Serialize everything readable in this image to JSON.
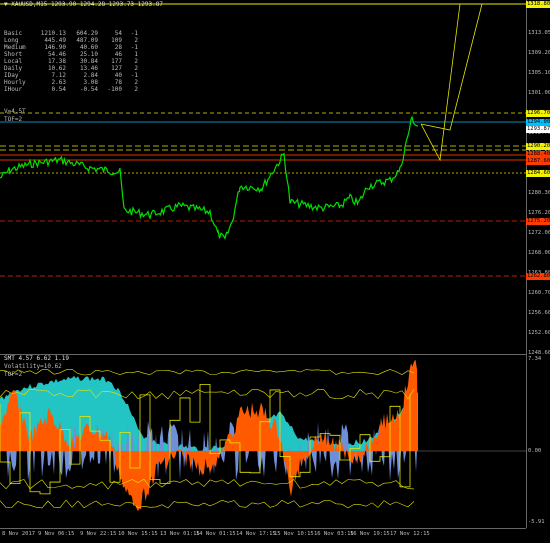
{
  "header": {
    "symbol_line": "▼ XAUUSD,M15  1293.90 1294.28 1293.73 1293.87"
  },
  "info_table": {
    "rows": [
      {
        "name": "Basic",
        "a": "1210.13",
        "b": "604.29",
        "c": "54",
        "d": "-1"
      },
      {
        "name": "Long",
        "a": "445.49",
        "b": "487.09",
        "c": "109",
        "d": "2"
      },
      {
        "name": "Medium",
        "a": "146.90",
        "b": "40.60",
        "c": "28",
        "d": "-1"
      },
      {
        "name": "Short",
        "a": "54.46",
        "b": "25.10",
        "c": "46",
        "d": "1"
      },
      {
        "name": "Local",
        "a": "17.38",
        "b": "30.84",
        "c": "177",
        "d": "2"
      },
      {
        "name": "Daily",
        "a": "10.62",
        "b": "13.46",
        "c": "127",
        "d": "2"
      },
      {
        "name": "IDay",
        "a": "7.12",
        "b": "2.84",
        "c": "40",
        "d": "-1"
      },
      {
        "name": "Hourly",
        "a": "2.63",
        "b": "3.08",
        "c": "78",
        "d": "2"
      },
      {
        "name": "IHour",
        "a": "0.54",
        "b": "-0.54",
        "c": "-100",
        "d": "2"
      }
    ],
    "vol_label": "V=4.5T",
    "tof_label": "TOF=2"
  },
  "price_axis": {
    "ticks": [
      "1317.30",
      "1313.05",
      "1309.20",
      "1305.10",
      "1301.00",
      "1296.80",
      "1292.70",
      "1288.55",
      "1284.40",
      "1280.30",
      "1276.20",
      "1272.00",
      "1268.00",
      "1263.80",
      "1260.70",
      "1256.60",
      "1252.60",
      "1248.60"
    ],
    "flags": [
      {
        "label": "1318.80",
        "color": "#f2f200"
      },
      {
        "label": "1296.70",
        "color": "#f2f200"
      },
      {
        "label": "1294.00",
        "color": "#00c0ff"
      },
      {
        "label": "1293.87",
        "color": "#ffffff"
      },
      {
        "label": "1290.20",
        "color": "#f2f200"
      },
      {
        "label": "1288.40",
        "color": "#ff3c00"
      },
      {
        "label": "1287.60",
        "color": "#ff3c00"
      },
      {
        "label": "1284.60",
        "color": "#f2f200"
      },
      {
        "label": "1275.20",
        "color": "#ff3c00"
      },
      {
        "label": "1262.80",
        "color": "#ff3c00"
      }
    ]
  },
  "indicator": {
    "title": "SMT 4.57 6.62 1.19",
    "volatility": "Volatility=10.62",
    "tof": "TOF=2",
    "axis_top": "7.34",
    "axis_mid": "0.00",
    "axis_bottom": "-5.91"
  },
  "time_axis": {
    "labels": [
      "8 Nov 2017",
      "9 Nov 06:15",
      "9 Nov 22:15",
      "10 Nov 15:15",
      "13 Nov 01:15",
      "14 Nov 01:15",
      "14 Nov 17:15",
      "15 Nov 10:15",
      "16 Nov 03:15",
      "16 Nov 19:15",
      "17 Nov 12:15"
    ]
  },
  "colors": {
    "price_line": "#00e000",
    "yellow": "#e8e800",
    "red": "#e03000",
    "cyan": "#22c4c4",
    "orange": "#ff5a00",
    "blue": "#6f8fd8"
  }
}
